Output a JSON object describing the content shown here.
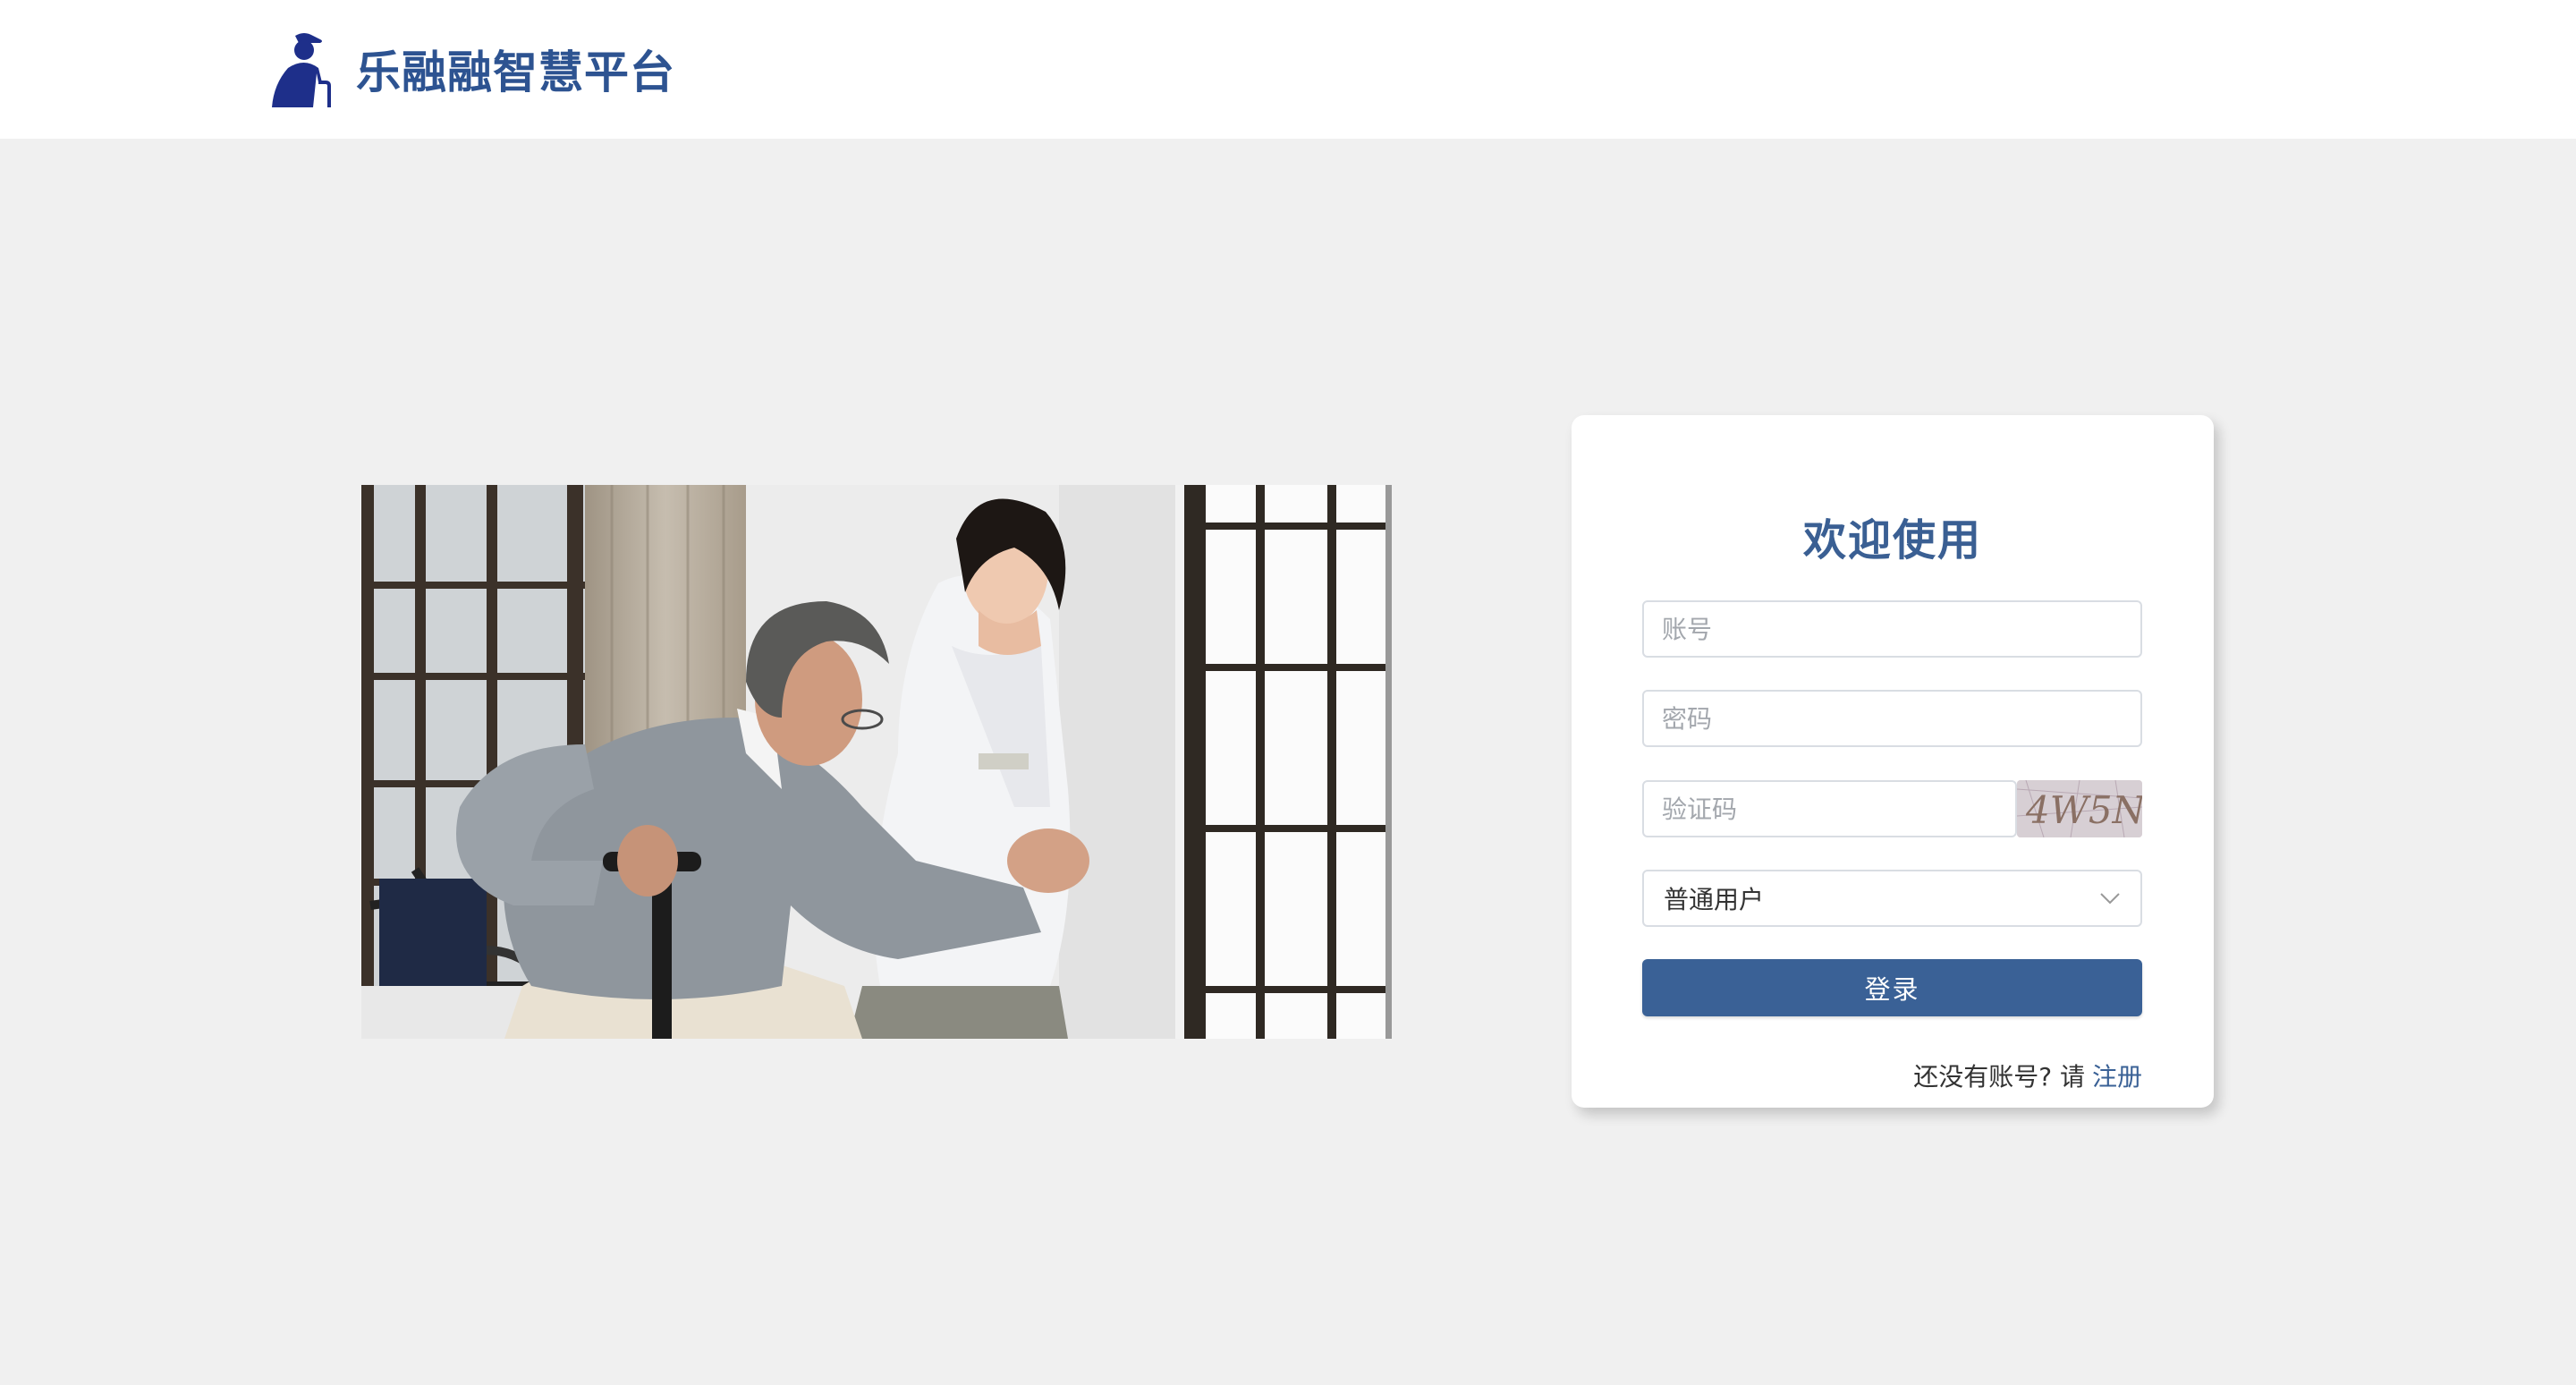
{
  "header": {
    "brand_title": "乐融融智慧平台",
    "logo_icon": "caregiver-logo-icon",
    "brand_color": "#2d5391"
  },
  "illustration": {
    "subject": "caregiver-helping-elderly-man-photo"
  },
  "login": {
    "title": "欢迎使用",
    "account_placeholder": "账号",
    "password_placeholder": "密码",
    "captcha_placeholder": "验证码",
    "captcha_text": "4W5N",
    "user_type_selected": "普通用户",
    "login_button": "登录",
    "register_prompt": "还没有账号? 请",
    "register_link": "注册",
    "accent_color": "#3a6196"
  }
}
